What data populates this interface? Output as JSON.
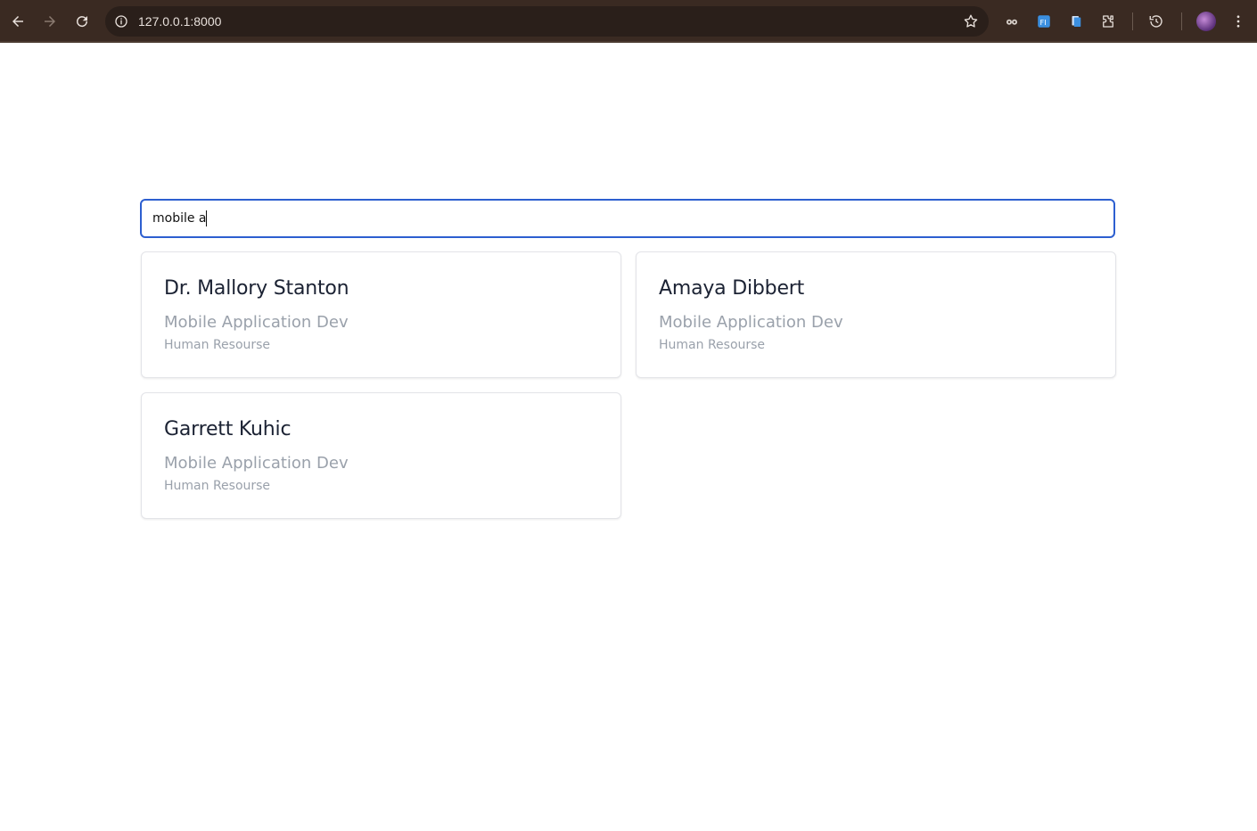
{
  "browser": {
    "url": "127.0.0.1:8000",
    "icons": [
      "back-icon",
      "forward-icon",
      "reload-icon",
      "site-info-icon",
      "bookmark-star-icon",
      "extension-icon",
      "extension-icon",
      "extension-icon",
      "extensions-puzzle-icon",
      "history-icon",
      "profile-avatar",
      "menu-kebab-icon"
    ]
  },
  "search": {
    "value": "mobile a"
  },
  "results": [
    {
      "name": "Dr. Mallory Stanton",
      "role": "Mobile Application Dev",
      "department": "Human Resourse"
    },
    {
      "name": "Amaya Dibbert",
      "role": "Mobile Application Dev",
      "department": "Human Resourse"
    },
    {
      "name": "Garrett Kuhic",
      "role": "Mobile Application Dev",
      "department": "Human Resourse"
    }
  ],
  "colors": {
    "chrome_bg": "#3a2a22",
    "focus_border": "#2d5fd0",
    "name_text": "#1b2233",
    "muted_text": "#9aa1ab"
  }
}
